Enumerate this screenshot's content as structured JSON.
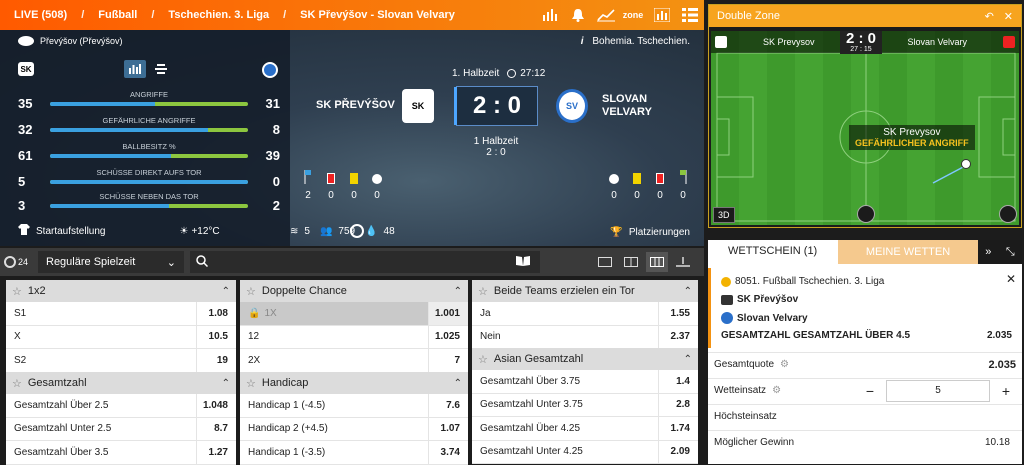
{
  "breadcrumb": {
    "live": "LIVE (508)",
    "sport": "Fußball",
    "league": "Tschechien. 3. Liga",
    "match": "SK Převýšov - Slovan Velvary"
  },
  "topbar_icons": {
    "zone_label": "zone"
  },
  "scoreboard": {
    "team_header": "Převýšov (Převýšov)",
    "info": "Bohemia. Tschechien.",
    "home": "SK PŘEVÝŠOV",
    "away_line1": "SLOVAN",
    "away_line2": "VELVARY",
    "score": "2 : 0",
    "period": "1. Halbzeit",
    "clock": "27:12",
    "halftime_label": "1 Halbzeit",
    "halftime_score": "2 : 0",
    "lineup_label": "Startaufstellung",
    "weather": "+12°C",
    "wind": "5",
    "attendance": "759",
    "humidity": "48",
    "standings_label": "Platzierungen",
    "stats": [
      {
        "label": "ANGRIFFE",
        "home": 35,
        "away": 31,
        "home_share": 0.53
      },
      {
        "label": "GEFÄHRLICHE ANGRIFFE",
        "home": 32,
        "away": 8,
        "home_share": 0.8
      },
      {
        "label": "BALLBESITZ %",
        "home": 61,
        "away": 39,
        "home_share": 0.61
      },
      {
        "label": "SCHÜSSE DIREKT AUFS TOR",
        "home": 5,
        "away": 0,
        "home_share": 1.0
      },
      {
        "label": "SCHÜSSE NEBEN DAS TOR",
        "home": 3,
        "away": 2,
        "home_share": 0.6
      }
    ],
    "home_cards": [
      "2",
      "0",
      "0",
      "0"
    ],
    "away_cards": [
      "0",
      "0",
      "0",
      "0"
    ]
  },
  "controls": {
    "period_select": "Reguläre Spielzeit",
    "timer": "24"
  },
  "markets": {
    "m1x2": {
      "title": "1x2",
      "rows": [
        {
          "name": "S1",
          "odd": "1.08"
        },
        {
          "name": "X",
          "odd": "10.5"
        },
        {
          "name": "S2",
          "odd": "19"
        }
      ]
    },
    "doppelte": {
      "title": "Doppelte Chance",
      "rows": [
        {
          "name": "1X",
          "odd": "1.001"
        },
        {
          "name": "12",
          "odd": "1.025"
        },
        {
          "name": "2X",
          "odd": "7"
        }
      ]
    },
    "beide": {
      "title": "Beide Teams erzielen ein Tor",
      "rows": [
        {
          "name": "Ja",
          "odd": "1.55"
        },
        {
          "name": "Nein",
          "odd": "2.37"
        }
      ]
    },
    "gesamt": {
      "title": "Gesamtzahl",
      "rows": [
        {
          "name": "Gesamtzahl Über 2.5",
          "odd": "1.048"
        },
        {
          "name": "Gesamtzahl Unter 2.5",
          "odd": "8.7"
        },
        {
          "name": "Gesamtzahl Über 3.5",
          "odd": "1.27"
        }
      ]
    },
    "handicap": {
      "title": "Handicap",
      "rows": [
        {
          "name": "Handicap 1 (-4.5)",
          "odd": "7.6"
        },
        {
          "name": "Handicap 2 (+4.5)",
          "odd": "1.07"
        },
        {
          "name": "Handicap 1 (-3.5)",
          "odd": "3.74"
        }
      ]
    },
    "asian": {
      "title": "Asian Gesamtzahl",
      "rows": [
        {
          "name": "Gesamtzahl Über 3.75",
          "odd": "1.4"
        },
        {
          "name": "Gesamtzahl Unter 3.75",
          "odd": "2.8"
        },
        {
          "name": "Gesamtzahl Über 4.25",
          "odd": "1.74"
        },
        {
          "name": "Gesamtzahl Unter 4.25",
          "odd": "2.09"
        }
      ]
    }
  },
  "double_zone": {
    "title": "Double Zone",
    "home": "SK Prevysov",
    "away": "Slovan Velvary",
    "score": "2 : 0",
    "clock": "27 : 15",
    "event_team": "SK Prevysov",
    "event_text": "GEFÄHRLICHER ANGRIFF",
    "btn_3d": "3D"
  },
  "betslip": {
    "tab_slip": "WETTSCHEIN (1)",
    "tab_mine": "MEINE WETTEN",
    "league": "8051. Fußball Tschechien. 3. Liga",
    "home": "SK Převýšov",
    "away": "Slovan Velvary",
    "selection": "GESAMTZAHL GESAMTZAHL ÜBER 4.5",
    "selection_odd": "2.035",
    "total_label": "Gesamtquote",
    "total_value": "2.035",
    "stake_label": "Wetteinsatz",
    "stake_value": "5",
    "max_label": "Höchsteinsatz",
    "win_label": "Möglicher Gewinn",
    "win_value": "10.18"
  }
}
